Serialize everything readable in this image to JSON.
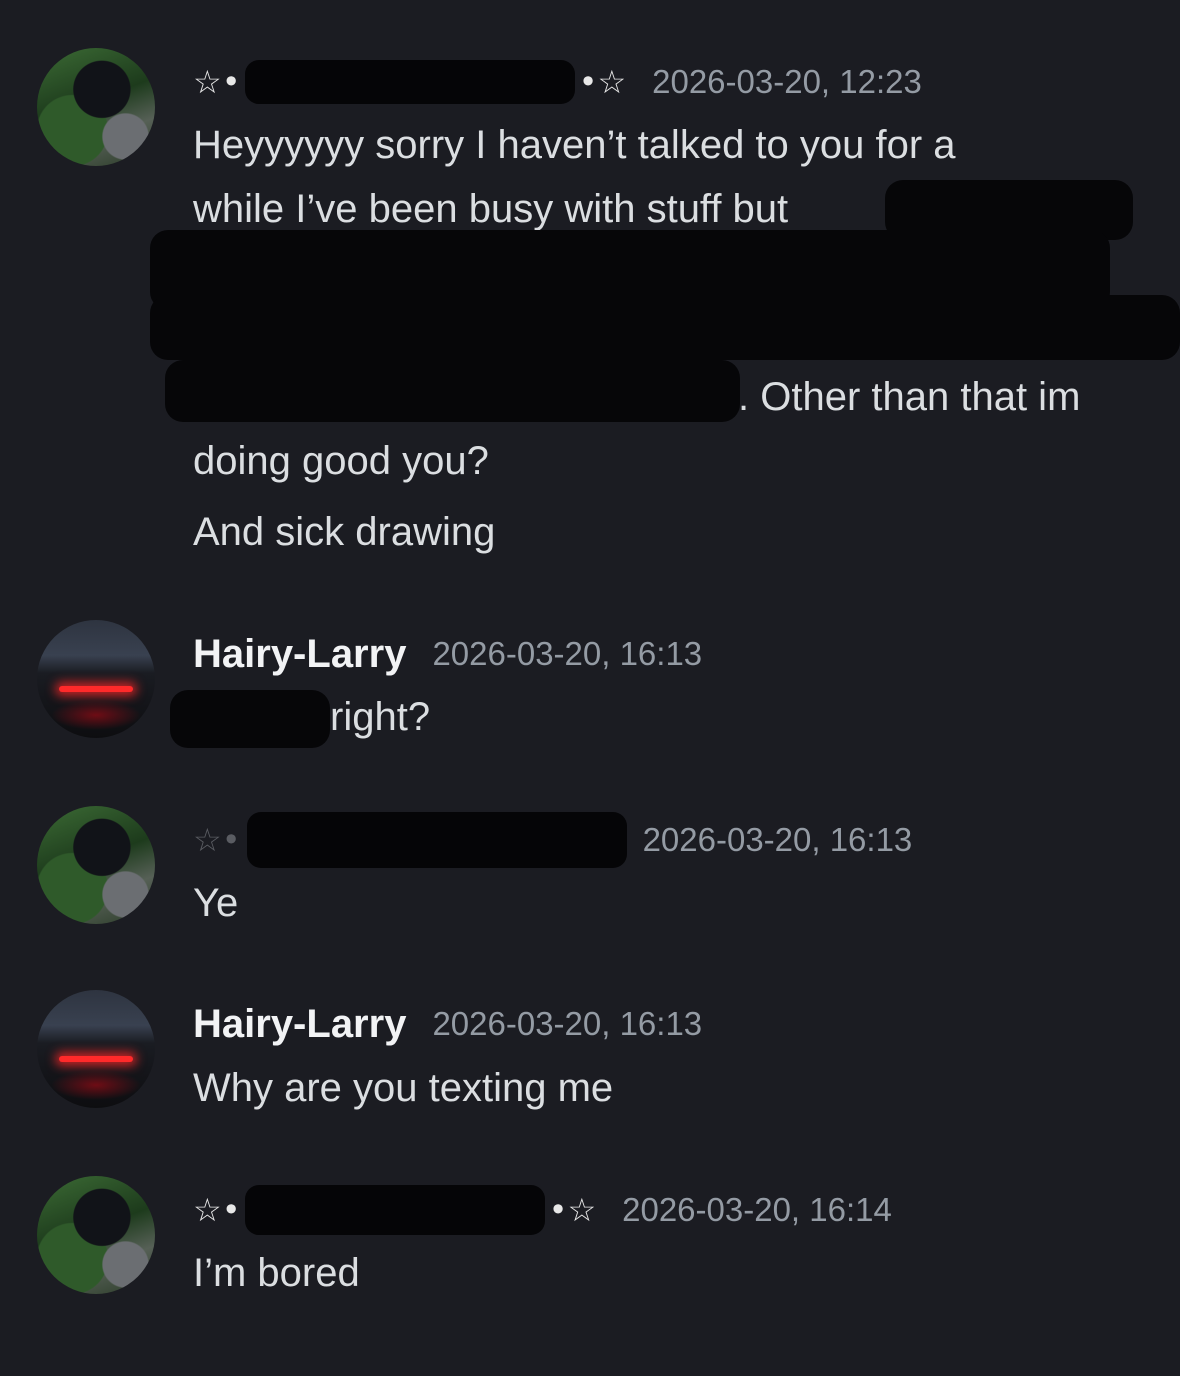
{
  "messages": [
    {
      "author_prefix": "☆•",
      "author_suffix": "•☆",
      "timestamp": "2026-03-20, 12:23",
      "lines": [
        "Heyyyyyy sorry I haven’t talked to you for a",
        "while I’ve been busy with stuff but",
        ". Other than that im",
        "doing good you?",
        "And sick drawing"
      ]
    },
    {
      "author": "Hairy-Larry",
      "timestamp": "2026-03-20, 16:13",
      "text": "right?"
    },
    {
      "author_prefix": "☆•",
      "timestamp": "2026-03-20, 16:13",
      "text": "Ye"
    },
    {
      "author": "Hairy-Larry",
      "timestamp": "2026-03-20, 16:13",
      "text": "Why are you texting me"
    },
    {
      "author_prefix": "☆•",
      "author_suffix": "•☆",
      "timestamp": "2026-03-20, 16:14",
      "text": "I’m bored"
    }
  ]
}
